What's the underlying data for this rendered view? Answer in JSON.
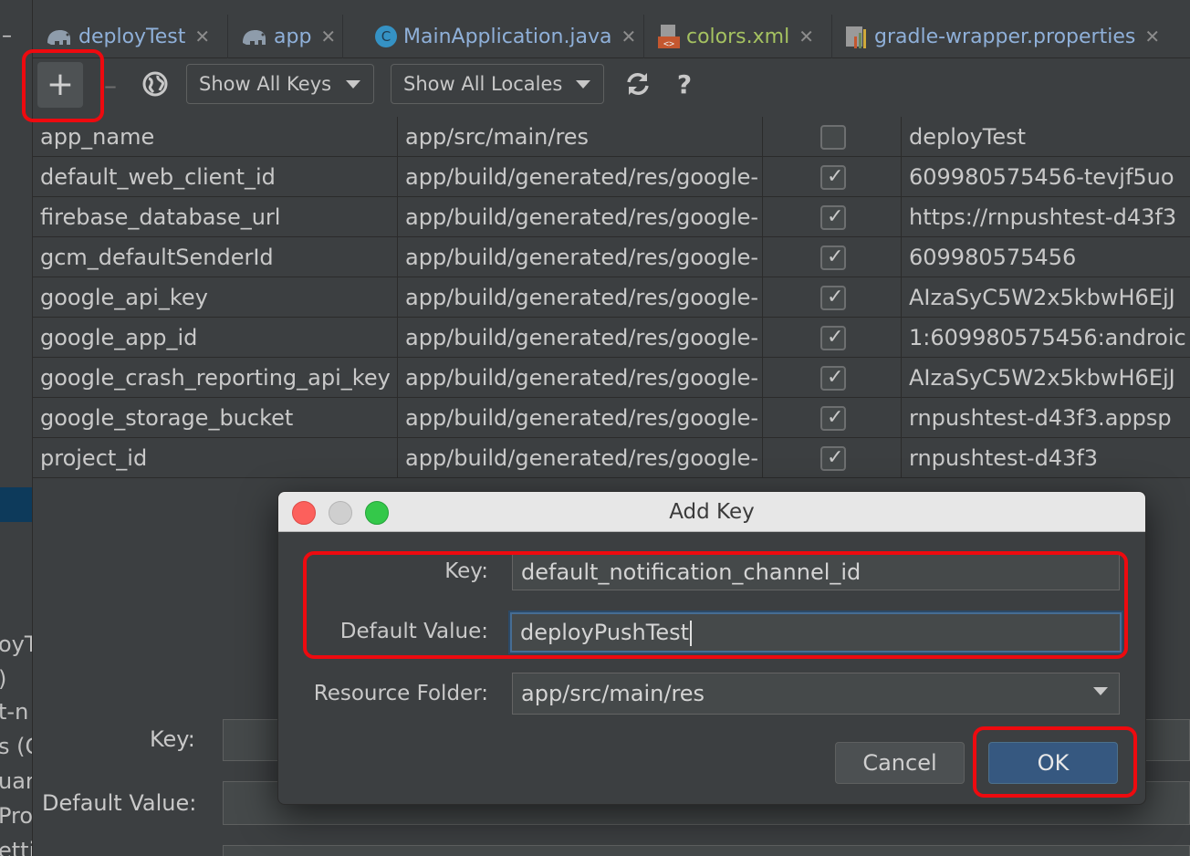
{
  "tabs": [
    {
      "label": "deployTest",
      "icon": "gradle-elephant-icon",
      "color": "#8fb0d9"
    },
    {
      "label": "app",
      "icon": "gradle-elephant-icon",
      "color": "#8fb0d9"
    },
    {
      "label": "MainApplication.java",
      "icon": "java-class-icon",
      "color": "#8fb0d9"
    },
    {
      "label": "colors.xml",
      "icon": "xml-file-icon",
      "color": "#a5c261"
    },
    {
      "label": "gradle-wrapper.properties",
      "icon": "properties-file-icon",
      "color": "#8fb0d9"
    }
  ],
  "toolbar": {
    "add_symbol": "+",
    "remove_symbol": "–",
    "keys_filter": "Show All Keys",
    "locales_filter": "Show All Locales",
    "help_symbol": "?"
  },
  "table": {
    "rows": [
      {
        "key": "app_name",
        "folder": "app/src/main/res",
        "untranslatable": false,
        "value": "deployTest"
      },
      {
        "key": "default_web_client_id",
        "folder": "app/build/generated/res/google-",
        "untranslatable": true,
        "value": "609980575456-tevjf5uo"
      },
      {
        "key": "firebase_database_url",
        "folder": "app/build/generated/res/google-",
        "untranslatable": true,
        "value": "https://rnpushtest-d43f3"
      },
      {
        "key": "gcm_defaultSenderId",
        "folder": "app/build/generated/res/google-",
        "untranslatable": true,
        "value": "609980575456"
      },
      {
        "key": "google_api_key",
        "folder": "app/build/generated/res/google-",
        "untranslatable": true,
        "value": "AIzaSyC5W2x5kbwH6EjJ"
      },
      {
        "key": "google_app_id",
        "folder": "app/build/generated/res/google-",
        "untranslatable": true,
        "value": "1:609980575456:androic"
      },
      {
        "key": "google_crash_reporting_api_key",
        "folder": "app/build/generated/res/google-",
        "untranslatable": true,
        "value": "AIzaSyC5W2x5kbwH6EjJ"
      },
      {
        "key": "google_storage_bucket",
        "folder": "app/build/generated/res/google-",
        "untranslatable": true,
        "value": "rnpushtest-d43f3.appsp"
      },
      {
        "key": "project_id",
        "folder": "app/build/generated/res/google-",
        "untranslatable": true,
        "value": "rnpushtest-d43f3"
      }
    ]
  },
  "detail": {
    "key_label": "Key:",
    "default_value_label": "Default Value:"
  },
  "left_fragments": [
    "oyT",
    ")",
    "t-n",
    "s (G",
    "uar",
    "Pro",
    "etti"
  ],
  "dialog": {
    "title": "Add Key",
    "key_label": "Key:",
    "key_value": "default_notification_channel_id",
    "default_value_label": "Default Value:",
    "default_value": "deployPushTest",
    "resource_folder_label": "Resource Folder:",
    "resource_folder_value": "app/src/main/res",
    "cancel_label": "Cancel",
    "ok_label": "OK"
  },
  "colors": {
    "background": "#3c3f41",
    "annotation": "#ee0a0f",
    "ok_button": "#365880",
    "traffic_close": "#fc605c",
    "traffic_min": "#c8c8c8",
    "traffic_max": "#34c84a"
  }
}
